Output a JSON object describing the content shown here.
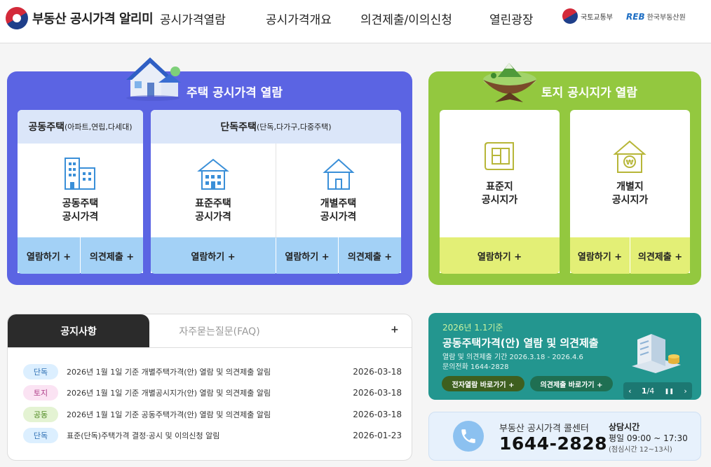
{
  "header": {
    "logo_text": "부동산 공시가격 알리미",
    "nav": [
      "공시가격열람",
      "공시가격개요",
      "의견제출/이의신청",
      "열린광장"
    ],
    "ministry": "국토교통부",
    "reb_mark": "REB",
    "reb_name": "한국부동산원"
  },
  "housing": {
    "title": "주택 공시가격 열람",
    "apartment": {
      "head": "공동주택",
      "head_sub": "(아파트,연립,다세대)",
      "label_line1": "공동주택",
      "label_line2": "공시가격",
      "view": "열람하기 +",
      "opinion": "의견제출 +"
    },
    "detached": {
      "head": "단독주택",
      "head_sub": "(단독,다가구,다중주택)",
      "standard_line1": "표준주택",
      "standard_line2": "공시가격",
      "individual_line1": "개별주택",
      "individual_line2": "공시가격",
      "standard_view": "열람하기 +",
      "individual_view": "열람하기 +",
      "individual_opinion": "의견제출 +"
    }
  },
  "land": {
    "title": "토지 공시지가 열람",
    "standard_line1": "표준지",
    "standard_line2": "공시지가",
    "individual_line1": "개별지",
    "individual_line2": "공시지가",
    "standard_view": "열람하기 +",
    "individual_view": "열람하기 +",
    "individual_opinion": "의견제출 +"
  },
  "notice": {
    "tab_active": "공지사항",
    "tab_inactive": "자주묻는질문(FAQ)",
    "more": "+",
    "items": [
      {
        "badge": "단독",
        "title": "2026년 1월 1일 기준 개별주택가격(안) 열람 및 의견제출 알림",
        "date": "2026-03-18"
      },
      {
        "badge": "토지",
        "title": "2026년 1월 1일 기준 개별공시지가(안) 열람 및 의견제출 알림",
        "date": "2026-03-18"
      },
      {
        "badge": "공동",
        "title": "2026년 1월 1일 기준 공동주택가격(안) 열람 및 의견제출 알림",
        "date": "2026-03-18"
      },
      {
        "badge": "단독",
        "title": "표준(단독)주택가격 결정·공시 및 이의신청 알림",
        "date": "2026-01-23"
      }
    ],
    "badge_colors": {
      "단독": {
        "bg": "#dcefff",
        "fg": "#2f6fb3"
      },
      "토지": {
        "bg": "#fbe3f3",
        "fg": "#b0408a"
      },
      "공동": {
        "bg": "#e4f3d3",
        "fg": "#4f8a22"
      }
    }
  },
  "banner": {
    "date": "2026년 1.1기준",
    "title": "공동주택가격(안) 열람 및 의견제출",
    "period": "열람 및 의견제출 기간 2026.3.18 - 2026.4.6",
    "phone": "문의전화 1644-2828",
    "btn_view": "전자열람 바로가기 +",
    "btn_opinion": "의견제출 바로가기 +",
    "page_current": "1",
    "page_sep": "/",
    "page_total": "4",
    "prev": "‹",
    "pause": "❚❚",
    "next": "›"
  },
  "call": {
    "label": "부동산 공시가격 콜센터",
    "number": "1644-2828",
    "hours_title": "상담시간",
    "hours": "평일 09:00 ~ 17:30",
    "lunch": "(점심시간 12~13시)"
  },
  "colors": {
    "housing_bg": "#5b64e3",
    "land_bg": "#93c83f",
    "banner_bg": "#23968f",
    "accent_blue": "#3a8fd8"
  }
}
